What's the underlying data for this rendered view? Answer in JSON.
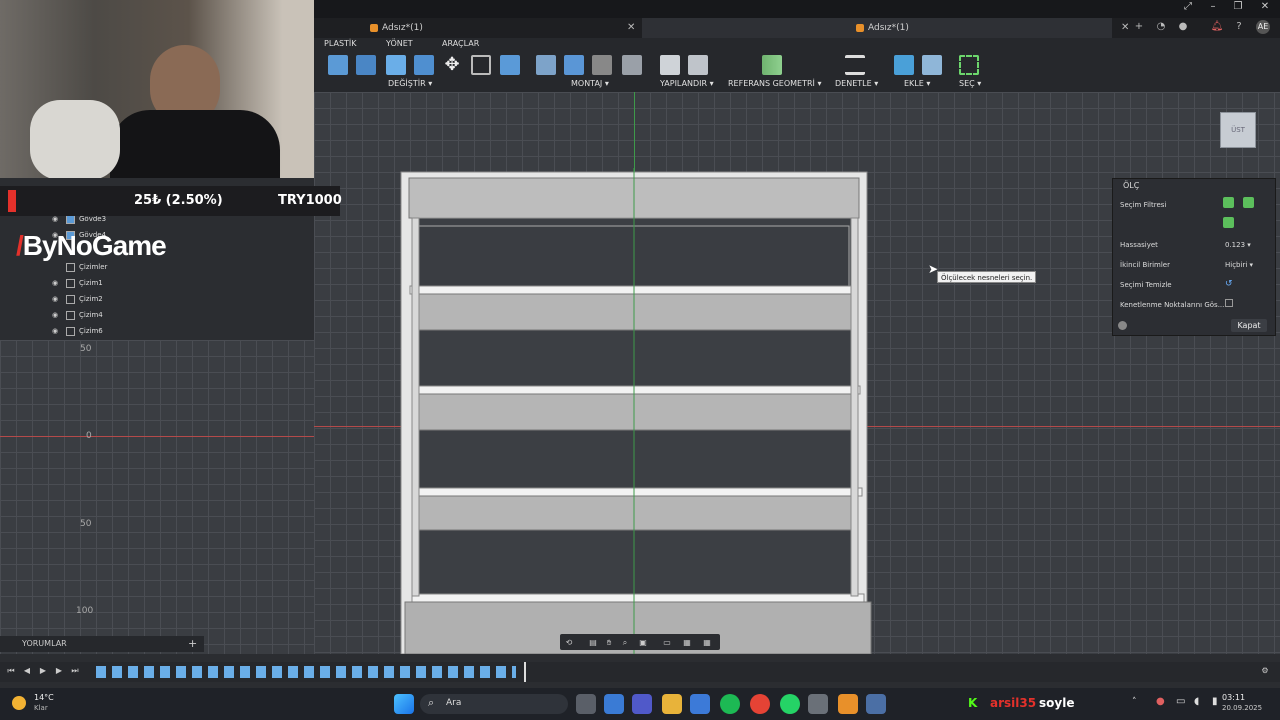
{
  "window": {
    "buttons": [
      "⤢",
      "–",
      "❐",
      "✕"
    ]
  },
  "tabs": [
    {
      "label": "Adsız*(1)",
      "active": false
    },
    {
      "label": "Adsız*(1)",
      "active": true
    }
  ],
  "tabbar_icons": [
    "plus-icon",
    "refresh-icon",
    "online-icon",
    "alert-icon",
    "help-icon"
  ],
  "user_initials": "AE",
  "ribbon": {
    "tabs": [
      "PLASTİK",
      "YÖNET",
      "ARAÇLAR"
    ],
    "groups": [
      "DEĞİŞTİR ▾",
      "MONTAJ ▾",
      "YAPILANDIR ▾",
      "REFERANS GEOMETRİ ▾",
      "DENETLE ▾",
      "EKLE ▾",
      "SEÇ ▾"
    ]
  },
  "browser": {
    "items": [
      "Gövde3",
      "Gövde4",
      "Çizimler",
      "Çizim1",
      "Çizim2",
      "Çizim4",
      "Çizim6"
    ]
  },
  "axis_labels": [
    "50",
    "0",
    "50",
    "100"
  ],
  "overlay": {
    "percent": "25₺ (2.50%)",
    "amount": "TRY1000",
    "brand": "ByNoGame"
  },
  "comments": {
    "label": "YORUMLAR",
    "add": "+"
  },
  "tooltip": "Ölçülecek nesneleri seçin.",
  "measure_panel": {
    "title": "ÖLÇ",
    "rows": [
      {
        "label": "Seçim Filtresi",
        "value": ""
      },
      {
        "label": "Hassasiyet",
        "value": "0.123 ▾"
      },
      {
        "label": "İkincil Birimler",
        "value": "Hiçbiri ▾"
      },
      {
        "label": "Seçimi Temizle",
        "value": "↺"
      },
      {
        "label": "Kenetlenme Noktalarını Gös...",
        "value": ""
      }
    ],
    "close_button": "Kapat"
  },
  "viewcube": "ÜST",
  "taskbar": {
    "weather_temp": "14°C",
    "weather_desc": "Klar",
    "search": "Ara",
    "stream_user": "arsil35",
    "stream_text": "soyle",
    "time": "03:11",
    "date": "20.09.2025"
  }
}
